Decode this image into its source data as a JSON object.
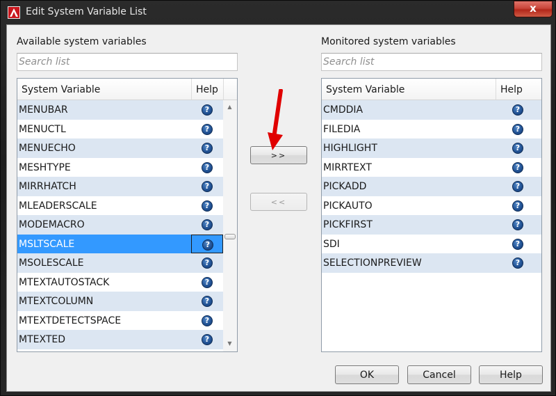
{
  "window": {
    "title": "Edit System Variable List",
    "close_label": "x"
  },
  "left": {
    "label": "Available system variables",
    "search_placeholder": "Search list",
    "columns": [
      "System Variable",
      "Help"
    ],
    "rows": [
      {
        "name": "MENUBAR"
      },
      {
        "name": "MENUCTL"
      },
      {
        "name": "MENUECHO"
      },
      {
        "name": "MESHTYPE"
      },
      {
        "name": "MIRRHATCH"
      },
      {
        "name": "MLEADERSCALE"
      },
      {
        "name": "MODEMACRO"
      },
      {
        "name": "MSLTSCALE",
        "selected": true
      },
      {
        "name": "MSOLESCALE"
      },
      {
        "name": "MTEXTAUTOSTACK"
      },
      {
        "name": "MTEXTCOLUMN"
      },
      {
        "name": "MTEXTDETECTSPACE"
      },
      {
        "name": "MTEXTED"
      }
    ]
  },
  "right": {
    "label": "Monitored system variables",
    "search_placeholder": "Search list",
    "columns": [
      "System Variable",
      "Help"
    ],
    "rows": [
      {
        "name": "CMDDIA"
      },
      {
        "name": "FILEDIA"
      },
      {
        "name": "HIGHLIGHT"
      },
      {
        "name": "MIRRTEXT"
      },
      {
        "name": "PICKADD"
      },
      {
        "name": "PICKAUTO"
      },
      {
        "name": "PICKFIRST"
      },
      {
        "name": "SDI"
      },
      {
        "name": "SELECTIONPREVIEW"
      }
    ]
  },
  "buttons": {
    "add": ">>",
    "remove": "<<",
    "ok": "OK",
    "cancel": "Cancel",
    "help": "Help"
  },
  "help_glyph": "?",
  "icons": {
    "help": "question-circle-icon",
    "annotation": "red-arrow-icon"
  },
  "colors": {
    "selection": "#3399ff",
    "alt_row": "#dce6f2",
    "help_icon": "#1f4f91",
    "annotation_arrow": "#e00000"
  }
}
